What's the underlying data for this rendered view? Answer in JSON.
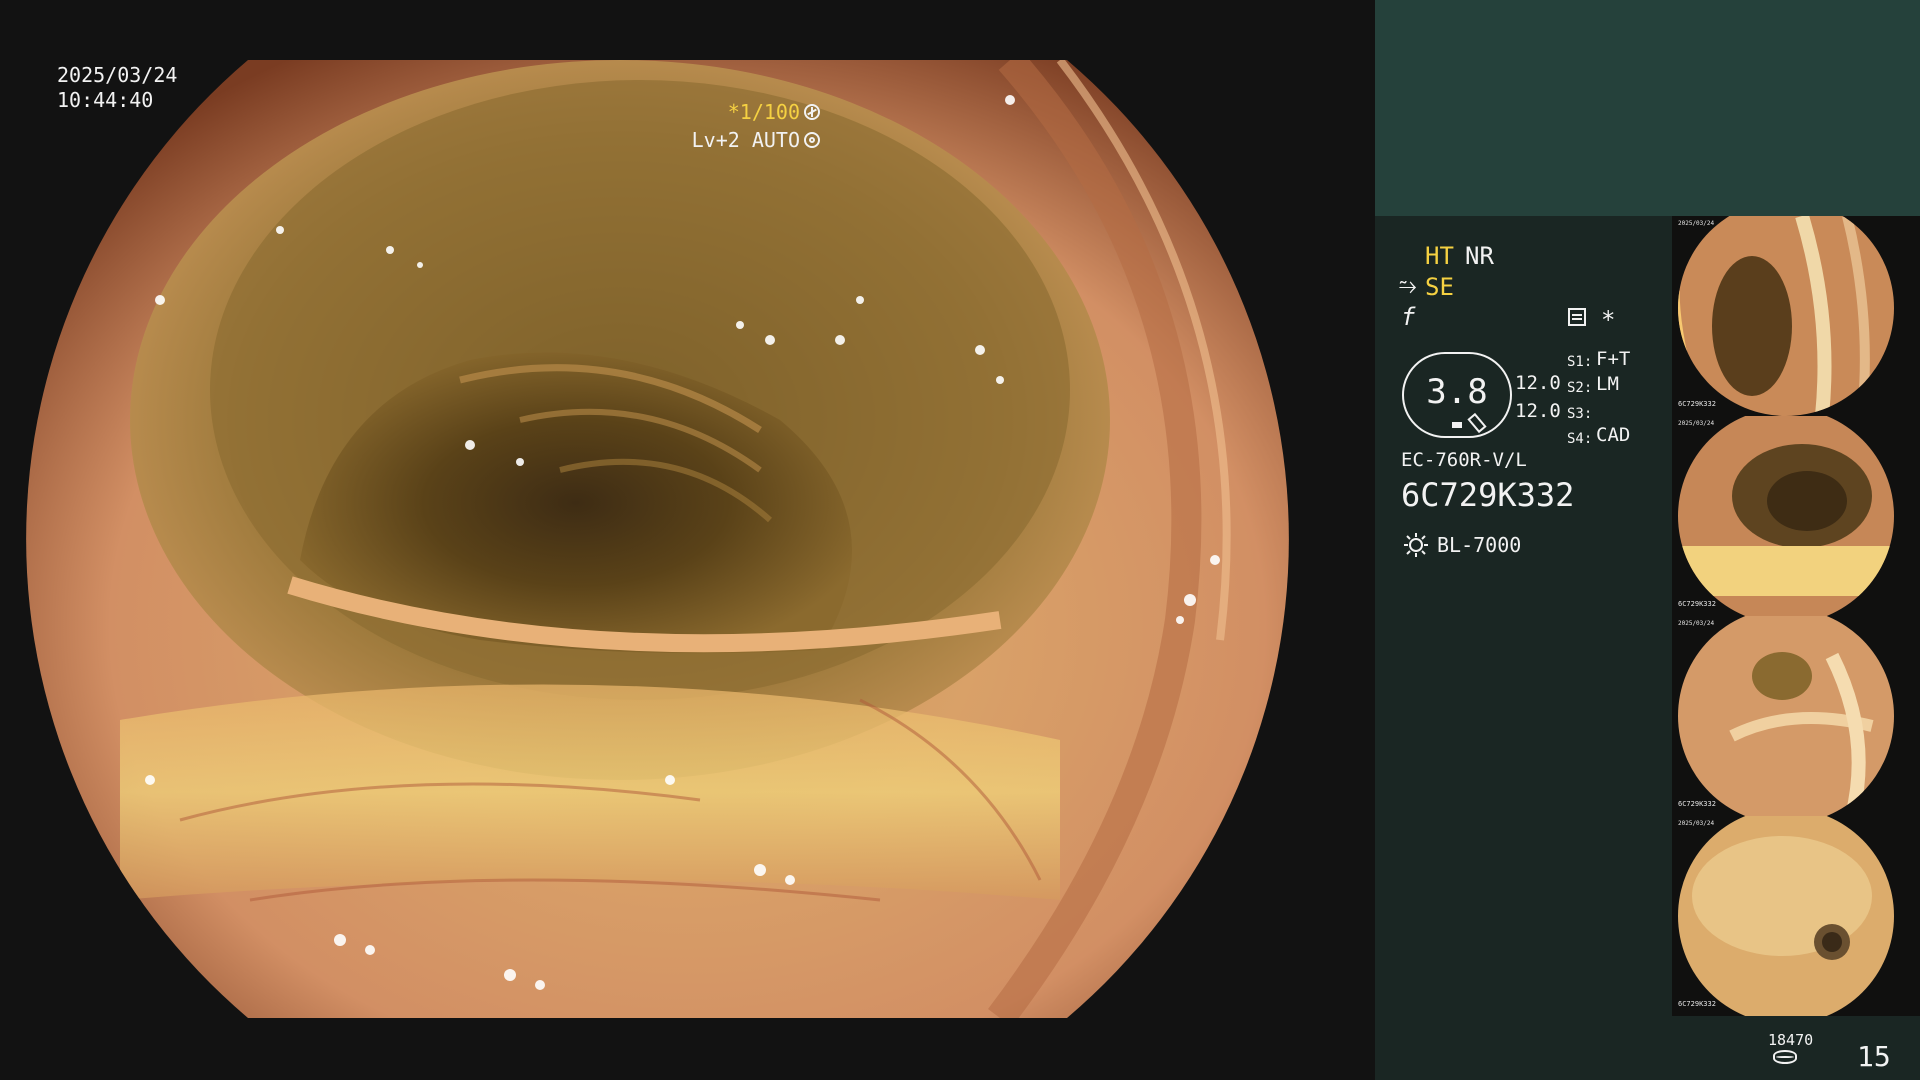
{
  "scope_view": {
    "date": "2025/03/24",
    "time": "10:44:40",
    "shutter": "*1/100",
    "shutter_icon": "aperture-icon",
    "level": "Lv+2 AUTO",
    "level_icon": "iris-icon"
  },
  "info_panel": {
    "modes": {
      "ht": "HT",
      "nr": "NR",
      "se_icon": "⥲",
      "se": "SE",
      "f_icon": "f"
    },
    "asterisk": "*",
    "zoom": "3.8",
    "values": [
      "12.0",
      "12.0"
    ],
    "switches": [
      {
        "label": "S1:",
        "value": "F+T"
      },
      {
        "label": "S2:",
        "value": "LM"
      },
      {
        "label": "S3:",
        "value": ""
      },
      {
        "label": "S4:",
        "value": "CAD"
      }
    ],
    "scope_model": "EC-760R-V/L",
    "scope_serial": "6C729K332",
    "light_source": "BL-7000",
    "storage_count": "18470",
    "image_count": "15",
    "thumbnails": [
      {
        "serial": "6C729K332",
        "date": "2025/03/24"
      },
      {
        "serial": "6C729K332",
        "date": "2025/03/24"
      },
      {
        "serial": "6C729K332",
        "date": "2025/03/24"
      },
      {
        "serial": "6C729K332",
        "date": "2025/03/24"
      }
    ]
  },
  "colors": {
    "accent_yellow": "#f5d142",
    "panel_dark": "#1a2623",
    "panel_band": "#25413b",
    "background": "#121212"
  }
}
